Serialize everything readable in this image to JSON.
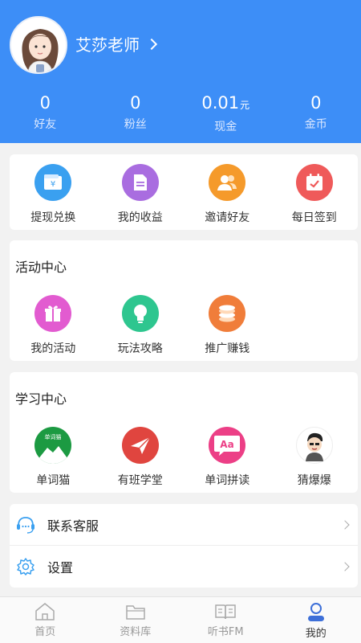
{
  "profile": {
    "name": "艾莎老师"
  },
  "stats": [
    {
      "value": "0",
      "unit": "",
      "label": "好友"
    },
    {
      "value": "0",
      "unit": "",
      "label": "粉丝"
    },
    {
      "value": "0.01",
      "unit": "元",
      "label": "现金"
    },
    {
      "value": "0",
      "unit": "",
      "label": "金币"
    }
  ],
  "quick_actions": [
    {
      "label": "提现兑换",
      "icon": "wallet-icon",
      "color": "#3aa0f0"
    },
    {
      "label": "我的收益",
      "icon": "document-icon",
      "color": "#a96de0"
    },
    {
      "label": "邀请好友",
      "icon": "friends-icon",
      "color": "#f59a2b"
    },
    {
      "label": "每日签到",
      "icon": "calendar-icon",
      "color": "#ef5a5a"
    }
  ],
  "activity_center": {
    "title": "活动中心",
    "items": [
      {
        "label": "我的活动",
        "icon": "gift-icon",
        "color": "#e25bd0"
      },
      {
        "label": "玩法攻略",
        "icon": "bulb-icon",
        "color": "#2ec68f"
      },
      {
        "label": "推广赚钱",
        "icon": "coins-icon",
        "color": "#f07d3a"
      }
    ]
  },
  "study_center": {
    "title": "学习中心",
    "items": [
      {
        "label": "单词猫",
        "icon": "word-cat-app-icon",
        "badge": "单词猫",
        "color": "#1c9a42"
      },
      {
        "label": "有班学堂",
        "icon": "paper-plane-app-icon",
        "color": "#e0453f"
      },
      {
        "label": "单词拼读",
        "icon": "phonics-app-icon",
        "badge": "Aa",
        "color": "#ec3f86"
      },
      {
        "label": "猜爆爆",
        "icon": "cartoon-app-icon",
        "color": "#ffffff"
      }
    ]
  },
  "menu": [
    {
      "label": "联系客服",
      "icon": "customer-service-icon"
    },
    {
      "label": "设置",
      "icon": "gear-icon"
    }
  ],
  "tabbar": [
    {
      "label": "首页",
      "icon": "home-icon",
      "active": false
    },
    {
      "label": "资料库",
      "icon": "folder-icon",
      "active": false
    },
    {
      "label": "听书FM",
      "icon": "book-icon",
      "active": false
    },
    {
      "label": "我的",
      "icon": "user-icon",
      "active": true
    }
  ],
  "colors": {
    "header": "#3d8ef7",
    "background": "#f2f2f2",
    "active_tab": "#3d6fd8"
  }
}
